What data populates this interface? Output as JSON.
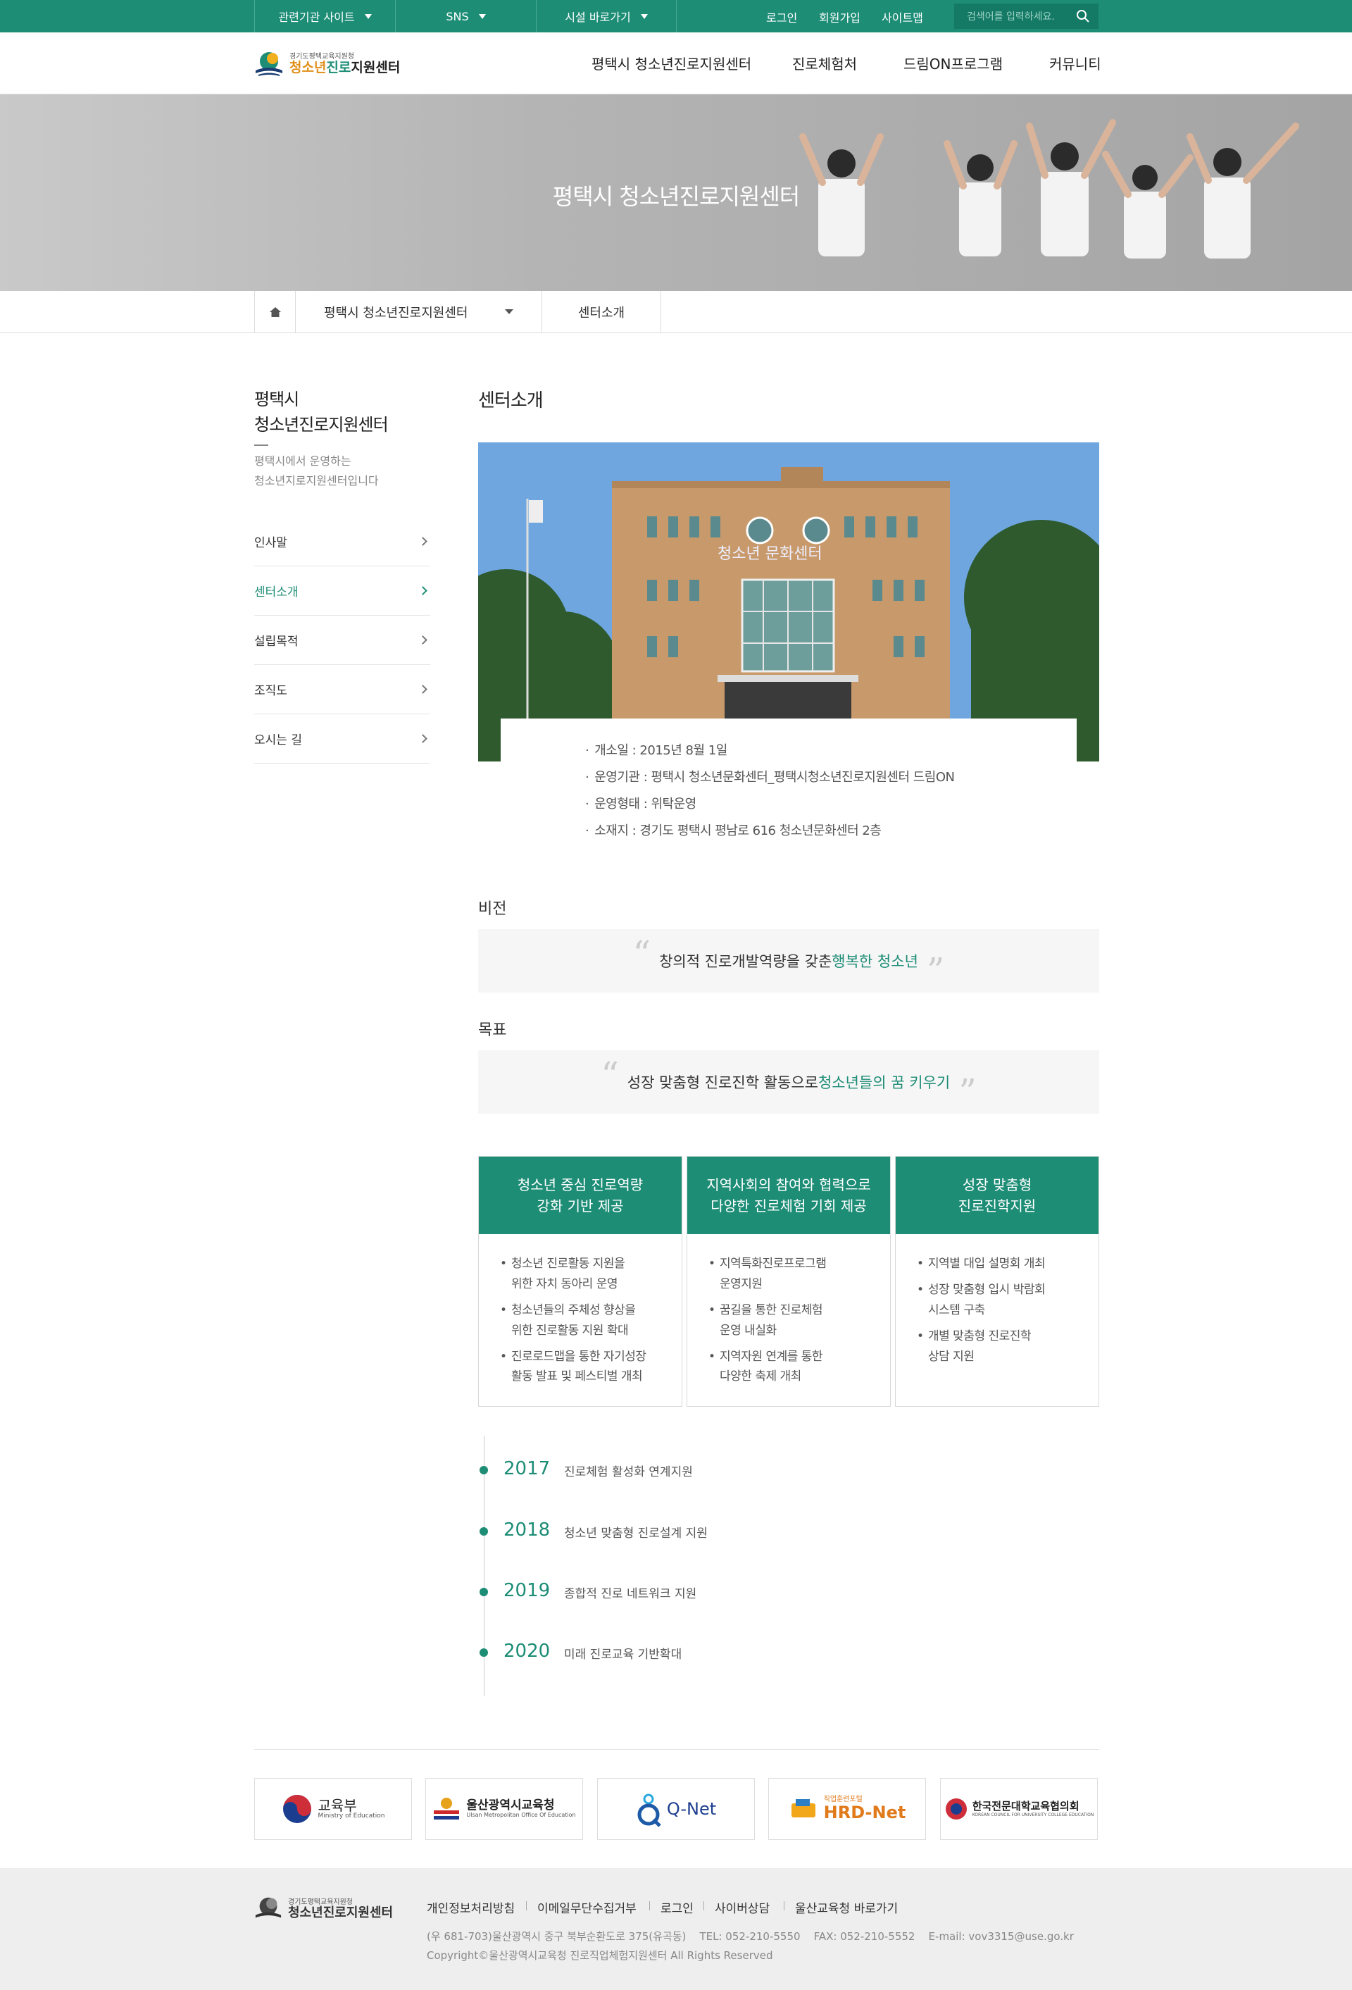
{
  "topbar": {
    "dropdowns": [
      "관련기관 사이트",
      "SNS",
      "시설 바로가기"
    ],
    "links": [
      "로그인",
      "회원가입",
      "사이트맵"
    ],
    "search_placeholder": "검색어를 입력하세요."
  },
  "logo": {
    "small": "경기도평택교육지원청",
    "main_a": "청소년",
    "main_b": "진로",
    "main_c": "지원센터"
  },
  "gnb": [
    "평택시 청소년진로지원센터",
    "진로체험처",
    "드림ON프로그램",
    "커뮤니티"
  ],
  "visual": {
    "title": "평택시 청소년진로지원센터"
  },
  "breadcrumb": {
    "level1": "평택시 청소년진로지원센터",
    "level2": "센터소개"
  },
  "sidebar": {
    "title_l1": "평택시",
    "title_l2": "청소년진로지원센터",
    "desc_l1": "평택시에서 운영하는",
    "desc_l2": "청소년지로지원센터입니다",
    "items": [
      "인사말",
      "센터소개",
      "설립목적",
      "조직도",
      "오시는 길"
    ],
    "active": "센터소개"
  },
  "content": {
    "title": "센터소개",
    "photo_sign": "청소년  문화센터",
    "info": [
      "개소일 : 2015년 8월 1일",
      "운영기관 : 평택시 청소년문화센터_평택시청소년진로지원센터 드림ON",
      "운영형태 : 위탁운영",
      "소재지 : 경기도 평택시 평남로 616 청소년문화센터 2층"
    ],
    "vision": {
      "heading": "비전",
      "text": "창의적 진로개발역량을 갖춘 ",
      "highlight": "행복한 청소년"
    },
    "goal": {
      "heading": "목표",
      "text": "성장 맞춤형 진로진학 활동으로 ",
      "highlight": "청소년들의 꿈 키우기"
    },
    "cards": [
      {
        "title_l1": "청소년 중심 진로역량",
        "title_l2": "강화 기반 제공",
        "items": [
          [
            "청소년 진로활동 지원을",
            "위한 자치 동아리 운영"
          ],
          [
            "청소년들의 주체성 향상을",
            "위한 진로활동 지원 확대"
          ],
          [
            "진로로드맵을 통한 자기성장",
            "활동 발표 및 페스티벌 개최"
          ]
        ]
      },
      {
        "title_l1": "지역사회의 참여와 협력으로",
        "title_l2": "다양한 진로체험 기회 제공",
        "items": [
          [
            "지역특화진로프로그램",
            "운영지원"
          ],
          [
            "꿈길을 통한 진로체험",
            "운영 내실화"
          ],
          [
            "지역자원 연계를 통한",
            "다양한 축제 개최"
          ]
        ]
      },
      {
        "title_l1": "성장 맞춤형",
        "title_l2": "진로진학지원",
        "items": [
          [
            "지역별 대입 설명회 개최",
            ""
          ],
          [
            "성장 맞춤형 입시 박람회",
            "시스템 구축"
          ],
          [
            "개별 맞춤형 진로진학",
            "상담 지원"
          ]
        ]
      }
    ],
    "timeline": [
      {
        "year": "2017",
        "desc": "진로체험 활성화 연계지원"
      },
      {
        "year": "2018",
        "desc": "청소년 맞춤형 진로설계 지원"
      },
      {
        "year": "2019",
        "desc": "종합적 진로 네트워크 지원"
      },
      {
        "year": "2020",
        "desc": "미래 진로교육 기반확대"
      }
    ]
  },
  "banners": [
    {
      "name": "교육부",
      "sub": "Ministry of Education"
    },
    {
      "name": "울산광역시교육청",
      "sub": "Ulsan Metropolitan Office Of Education"
    },
    {
      "name": "Q-Net",
      "sub": ""
    },
    {
      "name": "HRD-Net",
      "sub": "직업훈련포털"
    },
    {
      "name": "한국전문대학교육협의회",
      "sub": "KOREAN COUNCIL FOR UNIVERSITY COLLEGE EDUCATION"
    }
  ],
  "footer": {
    "links": [
      "개인정보처리방침",
      "이메일무단수집거부",
      "로그인",
      "사이버상담",
      "울산교육청 바로가기"
    ],
    "address": "(우 681-703)울산광역시 중구 북부순환도로 375(유곡동)    TEL: 052-210-5550    FAX: 052-210-5552    E-mail: vov3315@use.go.kr",
    "copyright": "Copyright©울산광역시교육청 진로직업체험지원센터 All Rights Reserved"
  },
  "colors": {
    "accent": "#1d8d76",
    "topbar": "#1d8d76",
    "footer_bg": "#eeeeee"
  }
}
